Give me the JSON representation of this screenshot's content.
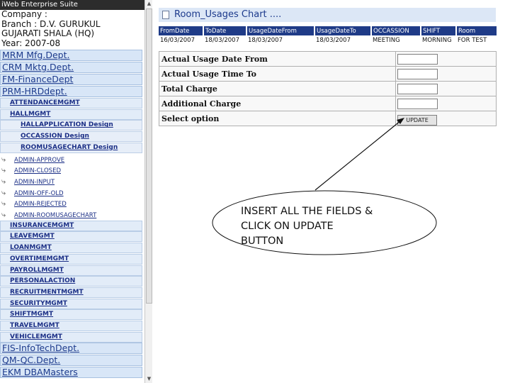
{
  "app": {
    "header": "iWeb Enterprise Suite",
    "company": "Company : ",
    "branch_line1": "Branch : D.V. GURUKUL",
    "branch_line2": "GUJARATI SHALA (HQ)",
    "year": "Year: 2007-08"
  },
  "sidebar": {
    "items": [
      {
        "type": "dept",
        "label": "MRM Mfg.Dept."
      },
      {
        "type": "dept",
        "label": "CRM Mktg.Dept."
      },
      {
        "type": "dept",
        "label": "FM-FinanceDept"
      },
      {
        "type": "dept",
        "label": "PRM-HRDdept."
      },
      {
        "type": "sub",
        "label": "ATTENDANCEMGMT"
      },
      {
        "type": "sub",
        "label": "HALLMGMT"
      },
      {
        "type": "sub2",
        "label": "HALLAPPLICATION Design"
      },
      {
        "type": "sub2",
        "label": "OCCASSION Design"
      },
      {
        "type": "sub2",
        "label": "ROOMUSAGECHART Design"
      },
      {
        "type": "admin",
        "label": "ADMIN-APPROVE"
      },
      {
        "type": "admin",
        "label": "ADMIN-CLOSED"
      },
      {
        "type": "admin",
        "label": "ADMIN-INPUT"
      },
      {
        "type": "admin",
        "label": "ADMIN-OFF-OLD"
      },
      {
        "type": "admin",
        "label": "ADMIN-REJECTED"
      },
      {
        "type": "admin",
        "label": "ADMIN-ROOMUSAGECHART"
      },
      {
        "type": "sub",
        "label": "INSURANCEMGMT"
      },
      {
        "type": "sub",
        "label": "LEAVEMGMT"
      },
      {
        "type": "sub",
        "label": "LOANMGMT"
      },
      {
        "type": "sub",
        "label": "OVERTIMEMGMT"
      },
      {
        "type": "sub",
        "label": "PAYROLLMGMT"
      },
      {
        "type": "sub",
        "label": "PERSONALACTION"
      },
      {
        "type": "sub",
        "label": "RECRUITMENTMGMT"
      },
      {
        "type": "sub",
        "label": "SECURITYMGMT"
      },
      {
        "type": "sub",
        "label": "SHIFTMGMT"
      },
      {
        "type": "sub",
        "label": "TRAVELMGMT"
      },
      {
        "type": "sub",
        "label": "VEHICLEMGMT"
      },
      {
        "type": "dept",
        "label": "FIS-InfoTechDept."
      },
      {
        "type": "dept",
        "label": "QM-QC.Dept."
      },
      {
        "type": "dept",
        "label": "EKM DBAMasters"
      }
    ]
  },
  "main": {
    "title": "Room_Usages Chart ....",
    "usage_table": {
      "headers": [
        "FromDate",
        "ToDate",
        "UsageDateFrom",
        "UsageDateTo",
        "OCCASSION",
        "SHIFT",
        "Room"
      ],
      "rows": [
        [
          "16/03/2007",
          "18/03/2007",
          "18/03/2007",
          "18/03/2007",
          "MEETING",
          "MORNING",
          "FOR TEST"
        ]
      ]
    },
    "form": {
      "usage_date_from_label": "Actual Usage Date From",
      "usage_time_to_label": "Actual Usage Time To",
      "total_charge_label": "Total Charge",
      "additional_charge_label": "Additional Charge",
      "select_option_label": "Select option",
      "update_button": "UPDATE"
    }
  },
  "annotation": {
    "line1": "INSERT ALL THE FIELDS &",
    "line2": "CLICK ON UPDATE",
    "line3": "BUTTON"
  },
  "colors": {
    "header_bar": "#2c2c2c",
    "nav_dept_bg": "#d8e6f7",
    "nav_link": "#1c3a8c",
    "table_header_bg": "#1f3b87"
  }
}
